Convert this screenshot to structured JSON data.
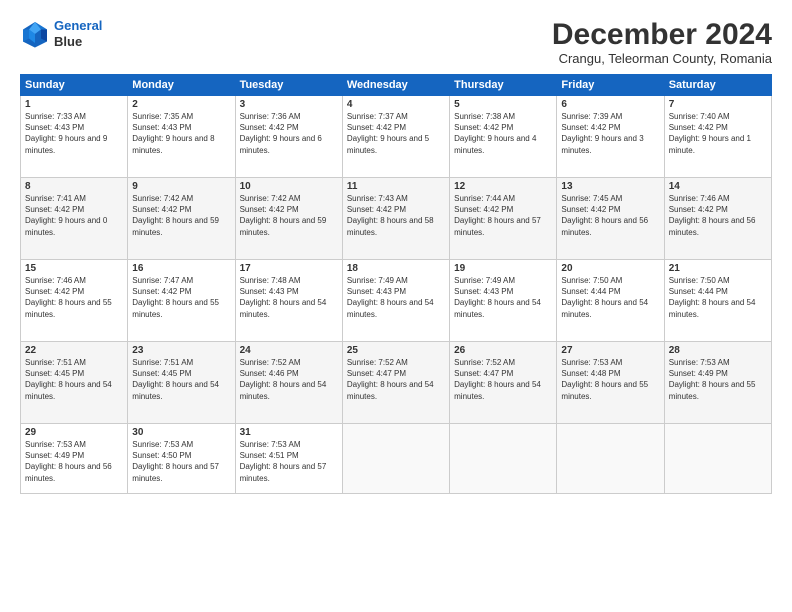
{
  "logo": {
    "line1": "General",
    "line2": "Blue"
  },
  "title": "December 2024",
  "subtitle": "Crangu, Teleorman County, Romania",
  "days_header": [
    "Sunday",
    "Monday",
    "Tuesday",
    "Wednesday",
    "Thursday",
    "Friday",
    "Saturday"
  ],
  "weeks": [
    [
      {
        "day": "1",
        "sunrise": "7:33 AM",
        "sunset": "4:43 PM",
        "daylight": "9 hours and 9 minutes."
      },
      {
        "day": "2",
        "sunrise": "7:35 AM",
        "sunset": "4:43 PM",
        "daylight": "9 hours and 8 minutes."
      },
      {
        "day": "3",
        "sunrise": "7:36 AM",
        "sunset": "4:42 PM",
        "daylight": "9 hours and 6 minutes."
      },
      {
        "day": "4",
        "sunrise": "7:37 AM",
        "sunset": "4:42 PM",
        "daylight": "9 hours and 5 minutes."
      },
      {
        "day": "5",
        "sunrise": "7:38 AM",
        "sunset": "4:42 PM",
        "daylight": "9 hours and 4 minutes."
      },
      {
        "day": "6",
        "sunrise": "7:39 AM",
        "sunset": "4:42 PM",
        "daylight": "9 hours and 3 minutes."
      },
      {
        "day": "7",
        "sunrise": "7:40 AM",
        "sunset": "4:42 PM",
        "daylight": "9 hours and 1 minute."
      }
    ],
    [
      {
        "day": "8",
        "sunrise": "7:41 AM",
        "sunset": "4:42 PM",
        "daylight": "9 hours and 0 minutes."
      },
      {
        "day": "9",
        "sunrise": "7:42 AM",
        "sunset": "4:42 PM",
        "daylight": "8 hours and 59 minutes."
      },
      {
        "day": "10",
        "sunrise": "7:42 AM",
        "sunset": "4:42 PM",
        "daylight": "8 hours and 59 minutes."
      },
      {
        "day": "11",
        "sunrise": "7:43 AM",
        "sunset": "4:42 PM",
        "daylight": "8 hours and 58 minutes."
      },
      {
        "day": "12",
        "sunrise": "7:44 AM",
        "sunset": "4:42 PM",
        "daylight": "8 hours and 57 minutes."
      },
      {
        "day": "13",
        "sunrise": "7:45 AM",
        "sunset": "4:42 PM",
        "daylight": "8 hours and 56 minutes."
      },
      {
        "day": "14",
        "sunrise": "7:46 AM",
        "sunset": "4:42 PM",
        "daylight": "8 hours and 56 minutes."
      }
    ],
    [
      {
        "day": "15",
        "sunrise": "7:46 AM",
        "sunset": "4:42 PM",
        "daylight": "8 hours and 55 minutes."
      },
      {
        "day": "16",
        "sunrise": "7:47 AM",
        "sunset": "4:42 PM",
        "daylight": "8 hours and 55 minutes."
      },
      {
        "day": "17",
        "sunrise": "7:48 AM",
        "sunset": "4:43 PM",
        "daylight": "8 hours and 54 minutes."
      },
      {
        "day": "18",
        "sunrise": "7:49 AM",
        "sunset": "4:43 PM",
        "daylight": "8 hours and 54 minutes."
      },
      {
        "day": "19",
        "sunrise": "7:49 AM",
        "sunset": "4:43 PM",
        "daylight": "8 hours and 54 minutes."
      },
      {
        "day": "20",
        "sunrise": "7:50 AM",
        "sunset": "4:44 PM",
        "daylight": "8 hours and 54 minutes."
      },
      {
        "day": "21",
        "sunrise": "7:50 AM",
        "sunset": "4:44 PM",
        "daylight": "8 hours and 54 minutes."
      }
    ],
    [
      {
        "day": "22",
        "sunrise": "7:51 AM",
        "sunset": "4:45 PM",
        "daylight": "8 hours and 54 minutes."
      },
      {
        "day": "23",
        "sunrise": "7:51 AM",
        "sunset": "4:45 PM",
        "daylight": "8 hours and 54 minutes."
      },
      {
        "day": "24",
        "sunrise": "7:52 AM",
        "sunset": "4:46 PM",
        "daylight": "8 hours and 54 minutes."
      },
      {
        "day": "25",
        "sunrise": "7:52 AM",
        "sunset": "4:47 PM",
        "daylight": "8 hours and 54 minutes."
      },
      {
        "day": "26",
        "sunrise": "7:52 AM",
        "sunset": "4:47 PM",
        "daylight": "8 hours and 54 minutes."
      },
      {
        "day": "27",
        "sunrise": "7:53 AM",
        "sunset": "4:48 PM",
        "daylight": "8 hours and 55 minutes."
      },
      {
        "day": "28",
        "sunrise": "7:53 AM",
        "sunset": "4:49 PM",
        "daylight": "8 hours and 55 minutes."
      }
    ],
    [
      {
        "day": "29",
        "sunrise": "7:53 AM",
        "sunset": "4:49 PM",
        "daylight": "8 hours and 56 minutes."
      },
      {
        "day": "30",
        "sunrise": "7:53 AM",
        "sunset": "4:50 PM",
        "daylight": "8 hours and 57 minutes."
      },
      {
        "day": "31",
        "sunrise": "7:53 AM",
        "sunset": "4:51 PM",
        "daylight": "8 hours and 57 minutes."
      },
      null,
      null,
      null,
      null
    ]
  ]
}
